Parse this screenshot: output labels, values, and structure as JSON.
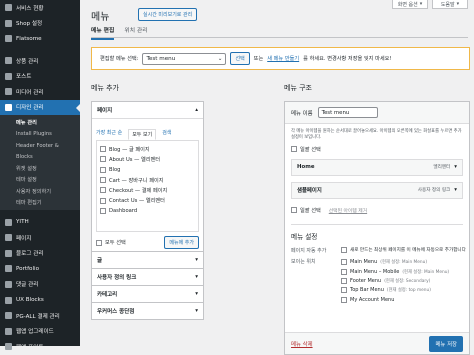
{
  "sidebar": {
    "items": [
      {
        "label": "서비스 현황"
      },
      {
        "label": "Shop 설정"
      },
      {
        "label": "Flatsome"
      },
      {
        "label": "상품 관리"
      },
      {
        "label": "포스트"
      },
      {
        "label": "미디어 관리"
      },
      {
        "label": "디자인 관리"
      }
    ],
    "submenu": [
      {
        "label": "메뉴 관리"
      },
      {
        "label": "Install Plugins"
      },
      {
        "label": "Header Footer &"
      },
      {
        "label": "Blocks"
      },
      {
        "label": "위젯 설정"
      },
      {
        "label": "테마 설정"
      },
      {
        "label": "사용자 정의하기"
      },
      {
        "label": "테마 편집기"
      }
    ],
    "items2": [
      {
        "label": "YITH"
      },
      {
        "label": "페이지"
      },
      {
        "label": "블로그 관리"
      },
      {
        "label": "Portfolio"
      },
      {
        "label": "댓글 관리"
      },
      {
        "label": "UX Blocks"
      },
      {
        "label": "PG-ALL 결제 관리"
      },
      {
        "label": "웹앱 업그레이드"
      },
      {
        "label": "웹앱 포인트"
      }
    ]
  },
  "top": {
    "screen_options": "화면 옵션",
    "help": "도움말"
  },
  "header": {
    "title": "메뉴",
    "live_button": "실시간 미리보기로 관리"
  },
  "tabs": [
    {
      "label": "메뉴 편집"
    },
    {
      "label": "위치 관리"
    }
  ],
  "select_bar": {
    "label": "편집할 메뉴 선택:",
    "selected": "Test menu",
    "select_button": "선택",
    "or_text": "또는",
    "create_link": "새 메뉴 만들기",
    "after_text": "를 하세요. 변경사항 저장을 잊지 마세요!"
  },
  "left": {
    "title": "메뉴 추가",
    "pages": {
      "heading": "페이지",
      "tabs": [
        "가장 최근 순",
        "모두 보기",
        "검색"
      ],
      "items": [
        "Blog — 글 페이지",
        "About Us — 엘리멘터",
        "Blog",
        "Cart — 장바구니 페이지",
        "Checkout — 결제 페이지",
        "Contact Us — 엘리멘터",
        "Dashboard"
      ],
      "select_all": "모두 선택",
      "add_button": "메뉴에 추가"
    },
    "accordions": [
      {
        "label": "글"
      },
      {
        "label": "사용자 정의 링크"
      },
      {
        "label": "카테고리"
      },
      {
        "label": "우커머스 종단점"
      }
    ]
  },
  "right": {
    "title": "메뉴 구조",
    "name_label": "메뉴 이름",
    "name_value": "Test menu",
    "instructions": "각 메뉴 아이템을 원하는 순서대로 끌어놓으세요. 아이템의 오른쪽에 있는 화살표를 누르면 추가 설정이 보입니다.",
    "bulk_select": "일괄 선택",
    "items": [
      {
        "title": "Home",
        "type": "엘리멘터"
      },
      {
        "title": "샘플페이지",
        "type": "사용자 정의 링크"
      }
    ],
    "bulk_select2": "일괄 선택",
    "remove_selected": "선택된 아이템 제거",
    "settings": {
      "title": "메뉴 설정",
      "auto_add_label": "페이지 자동 추가",
      "auto_add_text": "새로 만드는 최상위 페이지를 이 메뉴에 자동으로 추가합니다",
      "display_label": "보이는 위치",
      "locations": [
        {
          "name": "Main Menu",
          "note": "(현재 설정: Main Menu)"
        },
        {
          "name": "Main Menu – Mobile",
          "note": "(현재 설정: Main Menu)"
        },
        {
          "name": "Footer Menu",
          "note": "(현재 설정: Secondary)"
        },
        {
          "name": "Top Bar Menu",
          "note": "(현재 설정: top menu)"
        },
        {
          "name": "My Account Menu",
          "note": ""
        }
      ]
    },
    "delete_link": "메뉴 삭제",
    "save_button": "메뉴 저장"
  },
  "colors": {
    "accent": "#2271b1",
    "sidebar": "#1d2327",
    "highlight": "#f0b849"
  }
}
